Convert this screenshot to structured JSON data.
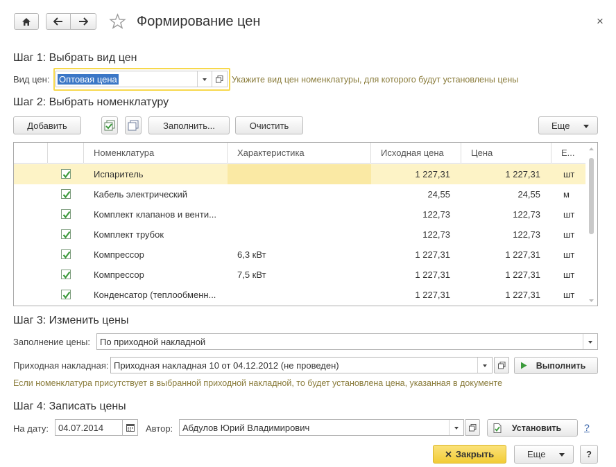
{
  "window": {
    "title": "Формирование цен",
    "close_glyph": "×"
  },
  "step1": {
    "heading": "Шаг 1: Выбрать вид цен",
    "price_type_label": "Вид цен:",
    "price_type_value": "Оптовая цена",
    "hint": "Укажите вид цен номенклатуры, для которого будут установлены цены"
  },
  "step2": {
    "heading": "Шаг 2: Выбрать номенклатуру",
    "add_label": "Добавить",
    "fill_label": "Заполнить...",
    "clear_label": "Очистить",
    "more_label": "Еще",
    "columns": [
      "Номенклатура",
      "Характеристика",
      "Исходная цена",
      "Цена",
      "Е..."
    ],
    "rows": [
      {
        "checked": true,
        "name": "Испаритель",
        "characteristic": "",
        "source_price": "1 227,31",
        "price": "1 227,31",
        "unit": "шт",
        "selected": true
      },
      {
        "checked": true,
        "name": "Кабель электрический",
        "characteristic": "",
        "source_price": "24,55",
        "price": "24,55",
        "unit": "м",
        "selected": false
      },
      {
        "checked": true,
        "name": "Комплект клапанов и венти...",
        "characteristic": "",
        "source_price": "122,73",
        "price": "122,73",
        "unit": "шт",
        "selected": false
      },
      {
        "checked": true,
        "name": "Комплект трубок",
        "characteristic": "",
        "source_price": "122,73",
        "price": "122,73",
        "unit": "шт",
        "selected": false
      },
      {
        "checked": true,
        "name": "Компрессор",
        "characteristic": "6,3 кВт",
        "source_price": "1 227,31",
        "price": "1 227,31",
        "unit": "шт",
        "selected": false
      },
      {
        "checked": true,
        "name": "Компрессор",
        "characteristic": "7,5 кВт",
        "source_price": "1 227,31",
        "price": "1 227,31",
        "unit": "шт",
        "selected": false
      },
      {
        "checked": true,
        "name": "Конденсатор (теплообменн...",
        "characteristic": "",
        "source_price": "1 227,31",
        "price": "1 227,31",
        "unit": "шт",
        "selected": false
      }
    ]
  },
  "step3": {
    "heading": "Шаг 3: Изменить цены",
    "fill_label": "Заполнение цены:",
    "fill_value": "По приходной накладной",
    "invoice_label": "Приходная накладная:",
    "invoice_value": "Приходная накладная 10 от 04.12.2012 (не проведен)",
    "run_label": "Выполнить",
    "note": "Если номенклатура присутствует в выбранной приходной накладной, то будет установлена цена, указанная в документе"
  },
  "step4": {
    "heading": "Шаг 4: Записать цены",
    "date_label": "На дату:",
    "date_value": "04.07.2014",
    "author_label": "Автор:",
    "author_value": "Абдулов Юрий Владимирович",
    "set_label": "Установить",
    "help_label": "?"
  },
  "footer": {
    "close_label": "Закрыть",
    "more_label": "Еще",
    "help_label": "?"
  },
  "colors": {
    "accent_yellow": "#f7d84b",
    "selected_row": "#fdf3c6",
    "selected_cell": "#fae9a4",
    "check_green": "#3a9a3a",
    "hint_text": "#8a7c3b",
    "link_blue": "#3461a8"
  }
}
